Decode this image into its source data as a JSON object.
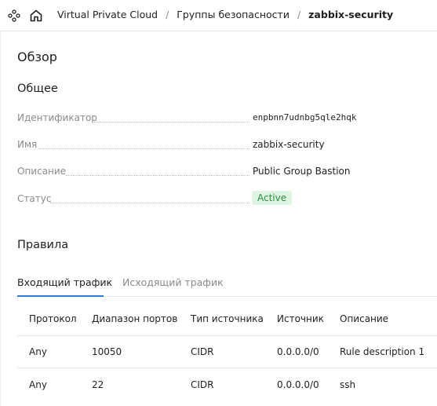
{
  "header": {
    "breadcrumbs": [
      "Virtual Private Cloud",
      "Группы безопасности",
      "zabbix-security"
    ],
    "separator": "/"
  },
  "overview": {
    "title": "Обзор",
    "general_title": "Общее",
    "properties": {
      "id_label": "Идентификатор",
      "id_value": "enpbnn7udnbg5qle2hqk",
      "name_label": "Имя",
      "name_value": "zabbix-security",
      "description_label": "Описание",
      "description_value": "Public Group Bastion",
      "status_label": "Статус",
      "status_value": "Active"
    }
  },
  "rules": {
    "title": "Правила",
    "tabs": [
      {
        "label": "Входящий трафик",
        "active": true
      },
      {
        "label": "Исходящий трафик",
        "active": false
      }
    ],
    "columns": [
      "Протокол",
      "Диапазон портов",
      "Тип источника",
      "Источник",
      "Описание"
    ],
    "rows": [
      [
        "Any",
        "10050",
        "CIDR",
        "0.0.0.0/0",
        "Rule description 1"
      ],
      [
        "Any",
        "22",
        "CIDR",
        "0.0.0.0/0",
        "ssh"
      ]
    ]
  },
  "colors": {
    "accent": "#2a7de1",
    "status_bg": "#dff5e3",
    "status_text": "#2e8c3e"
  },
  "icons": [
    "services-icon",
    "home-icon"
  ]
}
